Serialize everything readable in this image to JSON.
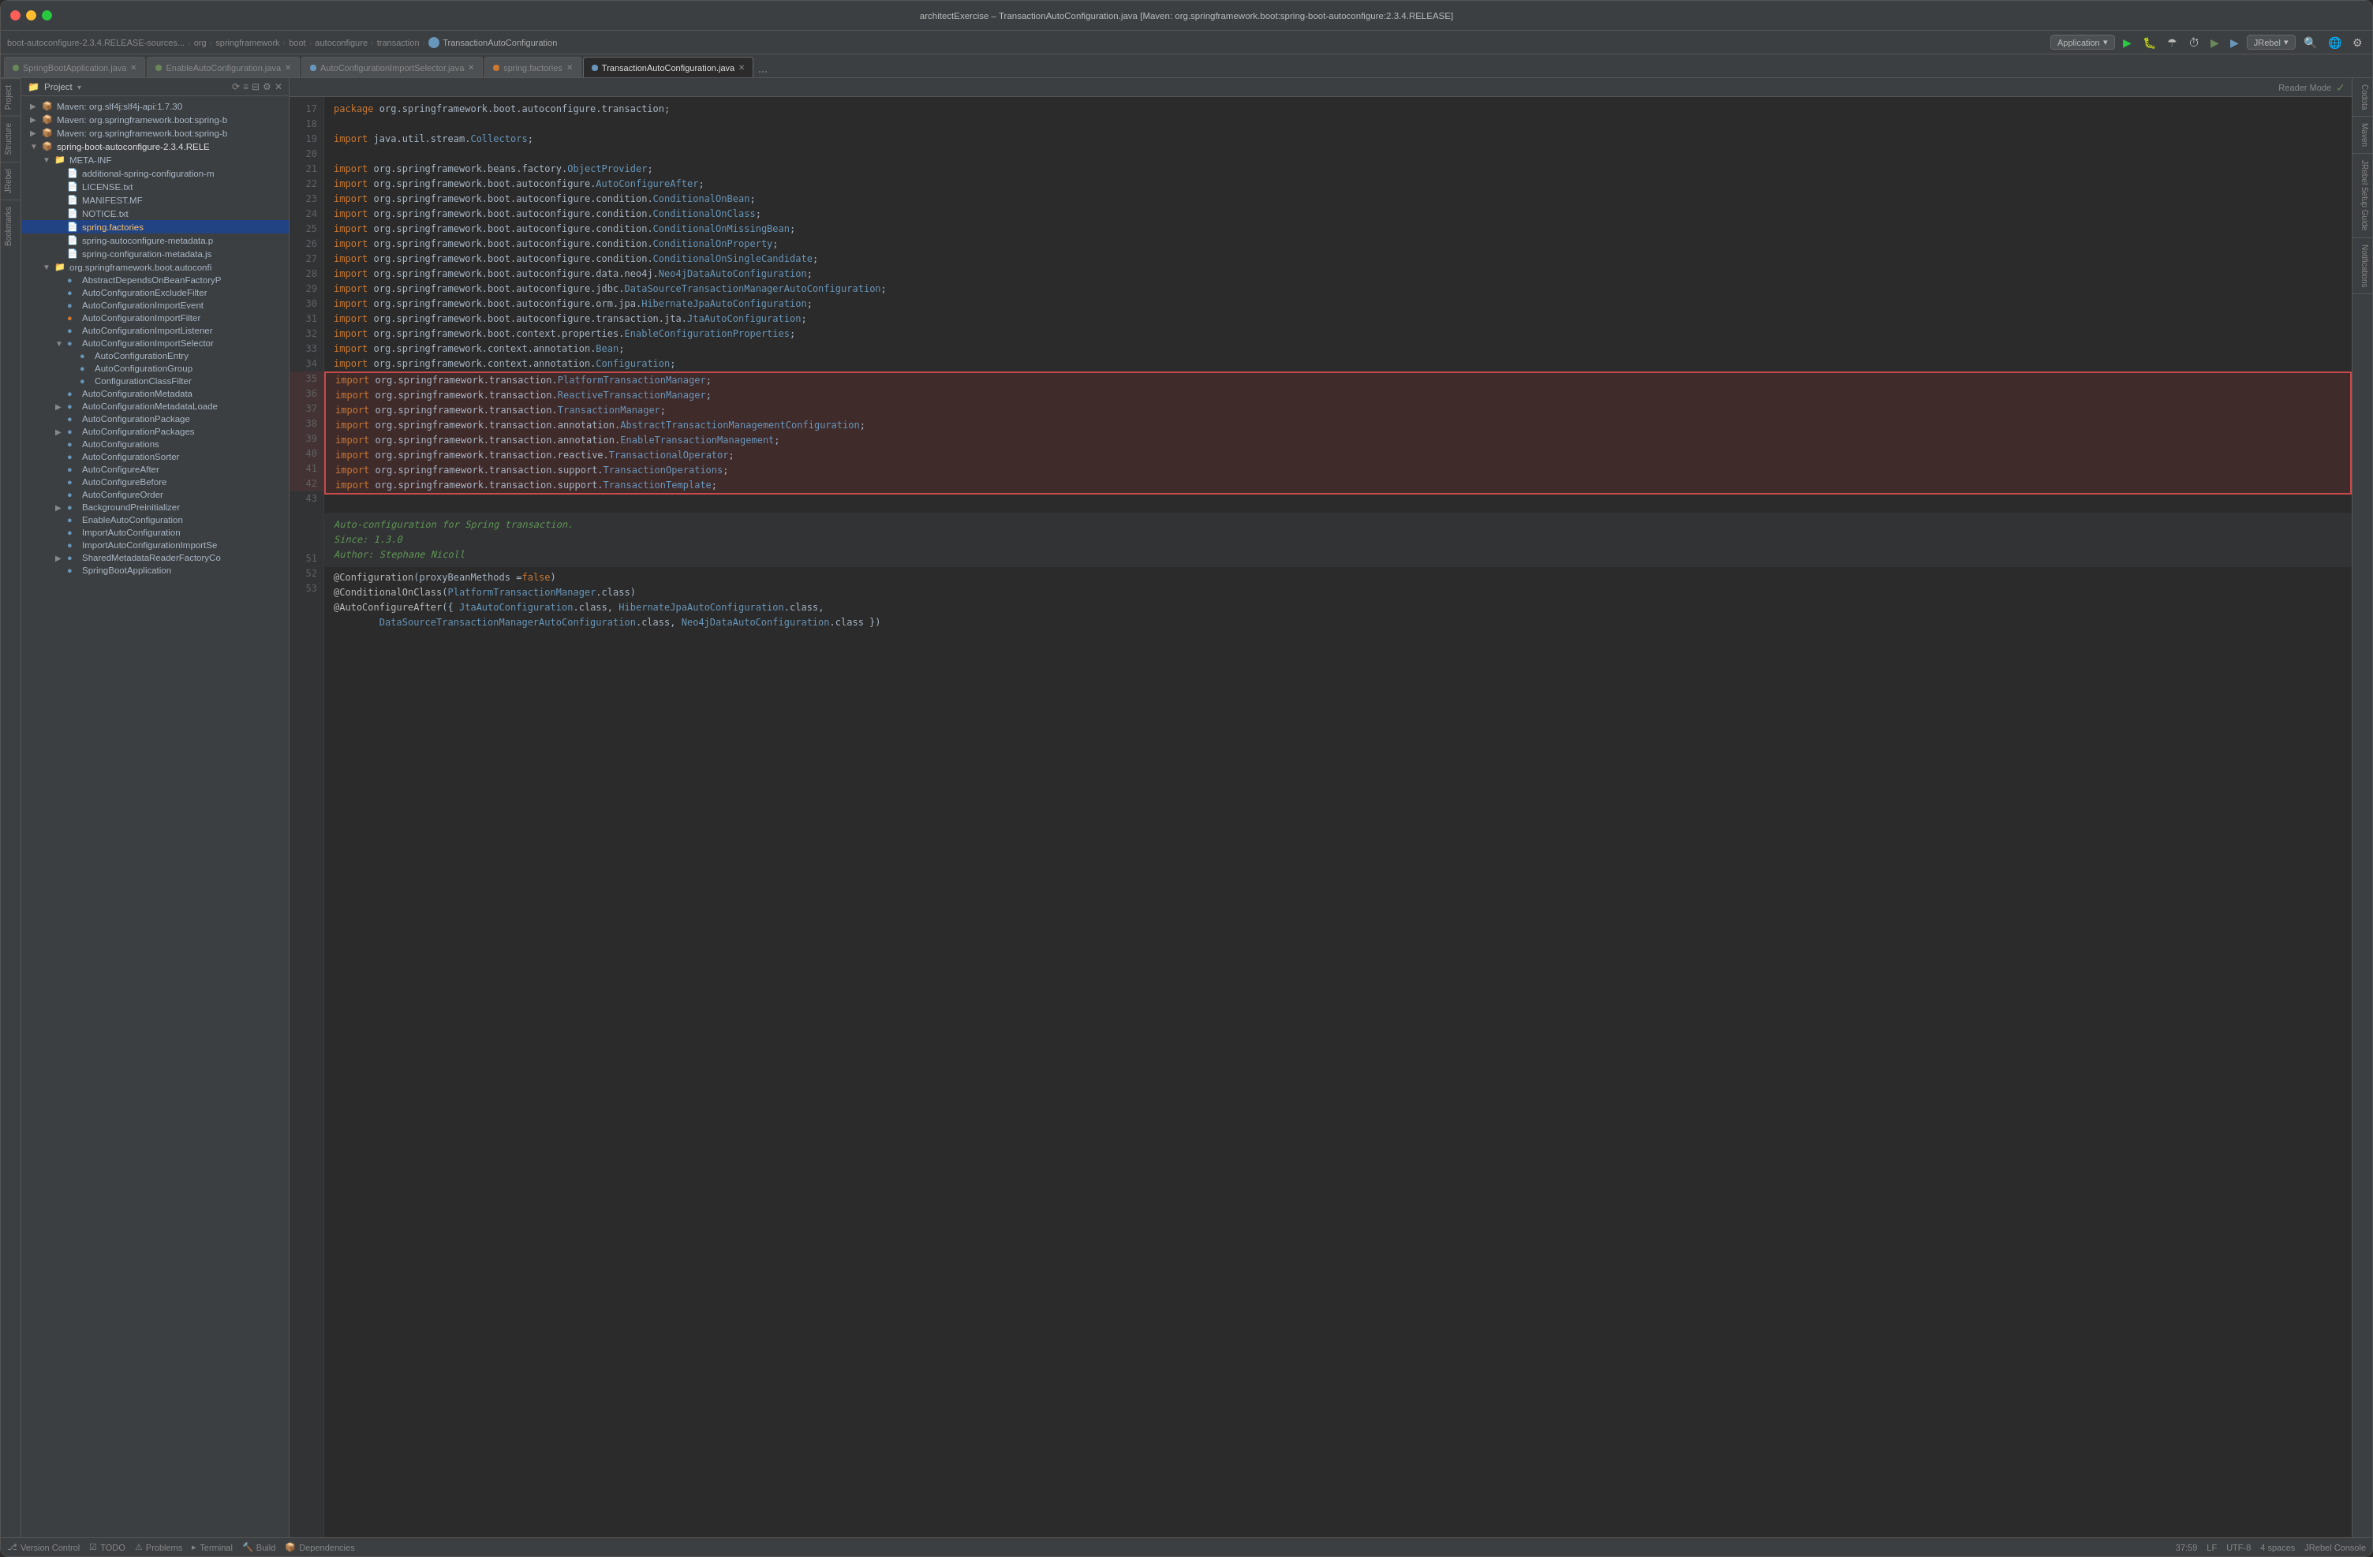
{
  "window": {
    "title": "architectExercise – TransactionAutoConfiguration.java [Maven: org.springframework.boot:spring-boot-autoconfigure:2.3.4.RELEASE]"
  },
  "breadcrumb": {
    "items": [
      "boot-autoconfigure-2.3.4.RELEASE-sources...",
      "org",
      "springframework",
      "boot",
      "autoconfigure",
      "transaction",
      "TransactionAutoConfiguration"
    ]
  },
  "run_controls": {
    "dropdown_label": "Application",
    "dropdown2_label": "JRebel"
  },
  "tabs": [
    {
      "label": "SpringBootApplication.java",
      "dot": "green",
      "active": false
    },
    {
      "label": "EnableAutoConfiguration.java",
      "dot": "green",
      "active": false
    },
    {
      "label": "AutoConfigurationImportSelector.java",
      "dot": "blue",
      "active": false
    },
    {
      "label": "spring.factories",
      "dot": "orange",
      "active": false
    },
    {
      "label": "TransactionAutoConfiguration.java",
      "dot": "blue",
      "active": true
    }
  ],
  "sidebar": {
    "title": "Project",
    "tree": [
      {
        "indent": 0,
        "arrow": "▶",
        "icon": "📦",
        "label": "Maven: org.slf4j:slf4j-api:1.7.30",
        "type": "normal"
      },
      {
        "indent": 0,
        "arrow": "▶",
        "icon": "📦",
        "label": "Maven: org.springframework.boot:spring-b",
        "type": "normal"
      },
      {
        "indent": 0,
        "arrow": "▶",
        "icon": "📦",
        "label": "Maven: org.springframework.boot:spring-b",
        "type": "normal"
      },
      {
        "indent": 0,
        "arrow": "▼",
        "icon": "📦",
        "label": "spring-boot-autoconfigure-2.3.4.RELE",
        "type": "bold"
      },
      {
        "indent": 1,
        "arrow": "▼",
        "icon": "📁",
        "label": "META-INF",
        "type": "normal"
      },
      {
        "indent": 2,
        "arrow": "",
        "icon": "📄",
        "label": "additional-spring-configuration-m",
        "type": "normal"
      },
      {
        "indent": 2,
        "arrow": "",
        "icon": "📄",
        "label": "LICENSE.txt",
        "type": "normal"
      },
      {
        "indent": 2,
        "arrow": "",
        "icon": "📄",
        "label": "MANIFEST.MF",
        "type": "normal"
      },
      {
        "indent": 2,
        "arrow": "",
        "icon": "📄",
        "label": "NOTICE.txt",
        "type": "normal"
      },
      {
        "indent": 2,
        "arrow": "",
        "icon": "📄",
        "label": "spring.factories",
        "type": "yellow"
      },
      {
        "indent": 2,
        "arrow": "",
        "icon": "📄",
        "label": "spring-autoconfigure-metadata.p",
        "type": "normal"
      },
      {
        "indent": 2,
        "arrow": "",
        "icon": "📄",
        "label": "spring-configuration-metadata.js",
        "type": "normal"
      },
      {
        "indent": 1,
        "arrow": "▼",
        "icon": "📁",
        "label": "org.springframework.boot.autoconfi",
        "type": "normal"
      },
      {
        "indent": 2,
        "arrow": "",
        "icon": "🔵",
        "label": "AbstractDependsOnBeanFactoryP",
        "type": "normal"
      },
      {
        "indent": 2,
        "arrow": "",
        "icon": "🔵",
        "label": "AutoConfigurationExcludeFilter",
        "type": "normal"
      },
      {
        "indent": 2,
        "arrow": "",
        "icon": "🔵",
        "label": "AutoConfigurationImportEvent",
        "type": "normal"
      },
      {
        "indent": 2,
        "arrow": "",
        "icon": "🟠",
        "label": "AutoConfigurationImportFilter",
        "type": "normal"
      },
      {
        "indent": 2,
        "arrow": "",
        "icon": "🔵",
        "label": "AutoConfigurationImportListener",
        "type": "normal"
      },
      {
        "indent": 2,
        "arrow": "▼",
        "icon": "🔵",
        "label": "AutoConfigurationImportSelector",
        "type": "normal"
      },
      {
        "indent": 3,
        "arrow": "",
        "icon": "🔵",
        "label": "AutoConfigurationEntry",
        "type": "normal"
      },
      {
        "indent": 3,
        "arrow": "",
        "icon": "🔵",
        "label": "AutoConfigurationGroup",
        "type": "normal"
      },
      {
        "indent": 3,
        "arrow": "",
        "icon": "🔵",
        "label": "ConfigurationClassFilter",
        "type": "normal"
      },
      {
        "indent": 2,
        "arrow": "",
        "icon": "🔵",
        "label": "AutoConfigurationMetadata",
        "type": "normal"
      },
      {
        "indent": 2,
        "arrow": "▶",
        "icon": "🔵",
        "label": "AutoConfigurationMetadataLoade",
        "type": "normal"
      },
      {
        "indent": 2,
        "arrow": "",
        "icon": "🔵",
        "label": "AutoConfigurationPackage",
        "type": "normal"
      },
      {
        "indent": 2,
        "arrow": "▶",
        "icon": "🔵",
        "label": "AutoConfigurationPackages",
        "type": "normal"
      },
      {
        "indent": 2,
        "arrow": "",
        "icon": "🔵",
        "label": "AutoConfigurations",
        "type": "normal"
      },
      {
        "indent": 2,
        "arrow": "",
        "icon": "🔵",
        "label": "AutoConfigurationSorter",
        "type": "normal"
      },
      {
        "indent": 2,
        "arrow": "",
        "icon": "🔵",
        "label": "AutoConfigureAfter",
        "type": "normal"
      },
      {
        "indent": 2,
        "arrow": "",
        "icon": "🔵",
        "label": "AutoConfigureBefore",
        "type": "normal"
      },
      {
        "indent": 2,
        "arrow": "",
        "icon": "🔵",
        "label": "AutoConfigureOrder",
        "type": "normal"
      },
      {
        "indent": 2,
        "arrow": "▶",
        "icon": "🔵",
        "label": "BackgroundPreinitializer",
        "type": "normal"
      },
      {
        "indent": 2,
        "arrow": "",
        "icon": "🔵",
        "label": "EnableAutoConfiguration",
        "type": "normal"
      },
      {
        "indent": 2,
        "arrow": "",
        "icon": "🔵",
        "label": "ImportAutoConfiguration",
        "type": "normal"
      },
      {
        "indent": 2,
        "arrow": "",
        "icon": "🔵",
        "label": "ImportAutoConfigurationImportSe",
        "type": "normal"
      },
      {
        "indent": 2,
        "arrow": "▶",
        "icon": "🔵",
        "label": "SharedMetadataReaderFactoryCo",
        "type": "normal"
      },
      {
        "indent": 2,
        "arrow": "",
        "icon": "🔵",
        "label": "SpringBootApplication",
        "type": "normal"
      }
    ]
  },
  "editor": {
    "reader_mode": "Reader Mode",
    "lines": [
      {
        "num": 17,
        "code": "package org.springframework.boot.autoconfigure.transaction;",
        "highlighted": false
      },
      {
        "num": 18,
        "code": "",
        "highlighted": false
      },
      {
        "num": 19,
        "code": "import java.util.stream.Collectors;",
        "highlighted": false
      },
      {
        "num": 20,
        "code": "",
        "highlighted": false
      },
      {
        "num": 21,
        "code": "import org.springframework.beans.factory.ObjectProvider;",
        "highlighted": false
      },
      {
        "num": 22,
        "code": "import org.springframework.boot.autoconfigure.AutoConfigureAfter;",
        "highlighted": false
      },
      {
        "num": 23,
        "code": "import org.springframework.boot.autoconfigure.condition.ConditionalOnBean;",
        "highlighted": false
      },
      {
        "num": 24,
        "code": "import org.springframework.boot.autoconfigure.condition.ConditionalOnClass;",
        "highlighted": false
      },
      {
        "num": 25,
        "code": "import org.springframework.boot.autoconfigure.condition.ConditionalOnMissingBean;",
        "highlighted": false
      },
      {
        "num": 26,
        "code": "import org.springframework.boot.autoconfigure.condition.ConditionalOnProperty;",
        "highlighted": false
      },
      {
        "num": 27,
        "code": "import org.springframework.boot.autoconfigure.condition.ConditionalOnSingleCandidate;",
        "highlighted": false
      },
      {
        "num": 28,
        "code": "import org.springframework.boot.autoconfigure.data.neo4j.Neo4jDataAutoConfiguration;",
        "highlighted": false
      },
      {
        "num": 29,
        "code": "import org.springframework.boot.autoconfigure.jdbc.DataSourceTransactionManagerAutoConfiguration;",
        "highlighted": false
      },
      {
        "num": 30,
        "code": "import org.springframework.boot.autoconfigure.orm.jpa.HibernateJpaAutoConfiguration;",
        "highlighted": false
      },
      {
        "num": 31,
        "code": "import org.springframework.boot.autoconfigure.transaction.jta.JtaAutoConfiguration;",
        "highlighted": false
      },
      {
        "num": 32,
        "code": "import org.springframework.boot.context.properties.EnableConfigurationProperties;",
        "highlighted": false
      },
      {
        "num": 33,
        "code": "import org.springframework.context.annotation.Bean;",
        "highlighted": false
      },
      {
        "num": 34,
        "code": "import org.springframework.context.annotation.Configuration;",
        "highlighted": false
      },
      {
        "num": 35,
        "code": "import org.springframework.transaction.PlatformTransactionManager;",
        "highlighted": true
      },
      {
        "num": 36,
        "code": "import org.springframework.transaction.ReactiveTransactionManager;",
        "highlighted": true
      },
      {
        "num": 37,
        "code": "import org.springframework.transaction.TransactionManager;",
        "highlighted": true
      },
      {
        "num": 38,
        "code": "import org.springframework.transaction.annotation.AbstractTransactionManagementConfiguration;",
        "highlighted": true
      },
      {
        "num": 39,
        "code": "import org.springframework.transaction.annotation.EnableTransactionManagement;",
        "highlighted": true
      },
      {
        "num": 40,
        "code": "import org.springframework.transaction.reactive.TransactionalOperator;",
        "highlighted": true
      },
      {
        "num": 41,
        "code": "import org.springframework.transaction.support.TransactionOperations;",
        "highlighted": true
      },
      {
        "num": 42,
        "code": "import org.springframework.transaction.support.TransactionTemplate;",
        "highlighted": true
      },
      {
        "num": 43,
        "code": "",
        "highlighted": false
      },
      {
        "num": "",
        "code": "    Auto-configuration for Spring transaction.",
        "highlighted": false,
        "comment": true
      },
      {
        "num": "",
        "code": "    Since:  1.3.0",
        "highlighted": false,
        "comment": true
      },
      {
        "num": "",
        "code": "    Author: Stephane Nicoll",
        "highlighted": false,
        "comment": true
      },
      {
        "num": 51,
        "code": "@Configuration(proxyBeanMethods = false)",
        "highlighted": false
      },
      {
        "num": 52,
        "code": "@ConditionalOnClass(PlatformTransactionManager.class)",
        "highlighted": false
      },
      {
        "num": 53,
        "code": "@AutoConfigureAfter({ JtaAutoConfiguration.class, HibernateJpaAutoConfiguration.class,",
        "highlighted": false
      },
      {
        "num": "",
        "code": "        DataSourceTransactionManagerAutoConfiguration.class, Neo4jDataAutoConfiguration.class })",
        "highlighted": false
      }
    ]
  },
  "status_bar": {
    "version_control": "Version Control",
    "todo": "TODO",
    "problems": "Problems",
    "terminal": "Terminal",
    "build": "Build",
    "dependencies": "Dependencies",
    "position": "37:59",
    "encoding": "UTF-8",
    "line_sep": "LF",
    "indent": "4 spaces"
  },
  "left_tabs": [
    "Project",
    "Structure",
    "JRebel",
    "Bookmarks"
  ],
  "right_tabs": [
    "Codota",
    "Maven",
    "JRebel Setup Guide",
    "Notifications"
  ]
}
